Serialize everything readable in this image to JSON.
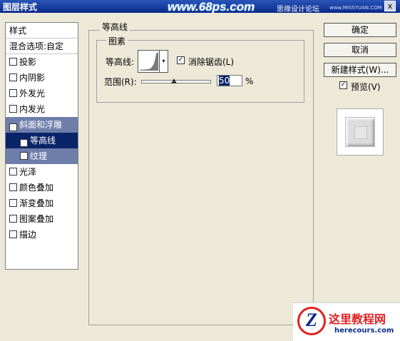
{
  "window": {
    "title": "图层样式",
    "watermark": "www.68ps.com",
    "watermark_cn": "思缘设计论坛",
    "watermark_small": "www.MISSYUAN.COM",
    "close_label": "x"
  },
  "sidebar": {
    "header": "样式",
    "blend_options": "混合选项:自定",
    "items": [
      {
        "label": "投影",
        "checked": false
      },
      {
        "label": "内阴影",
        "checked": false
      },
      {
        "label": "外发光",
        "checked": false
      },
      {
        "label": "内发光",
        "checked": false
      },
      {
        "label": "斜面和浮雕",
        "checked": true
      },
      {
        "label": "等高线",
        "checked": true
      },
      {
        "label": "纹理",
        "checked": false
      },
      {
        "label": "光泽",
        "checked": false
      },
      {
        "label": "颜色叠加",
        "checked": false
      },
      {
        "label": "渐变叠加",
        "checked": false
      },
      {
        "label": "图案叠加",
        "checked": false
      },
      {
        "label": "描边",
        "checked": false
      }
    ]
  },
  "panel": {
    "group_title": "等高线",
    "subgroup_title": "图素",
    "contour_label": "等高线:",
    "antialias_label": "消除锯齿(L)",
    "antialias_checked": true,
    "range_label": "范围(R):",
    "range_value": "50",
    "range_unit": "%",
    "range_slider_fraction": 0.5
  },
  "buttons": {
    "ok": "确定",
    "cancel": "取消",
    "new_style": "新建样式(W)...",
    "preview_label": "预览(V)",
    "preview_checked": true
  },
  "logo": {
    "name_cn": "这里教程网",
    "site": "herecours.com"
  }
}
